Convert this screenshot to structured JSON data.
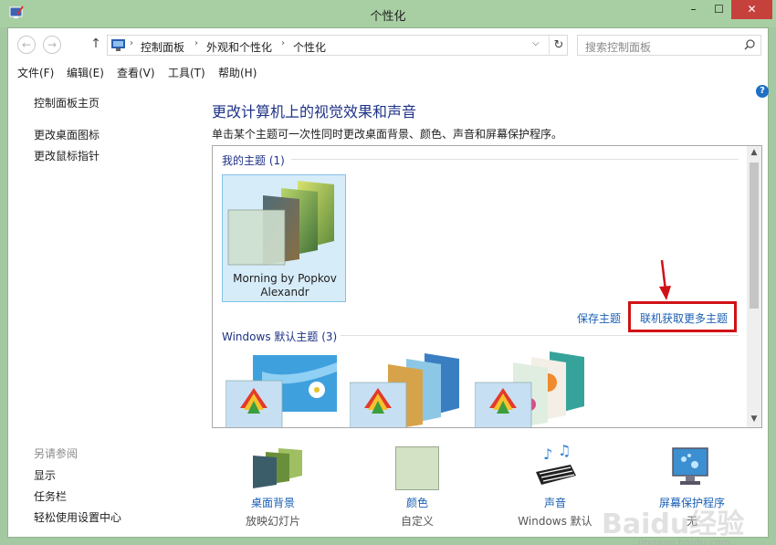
{
  "window": {
    "title": "个性化",
    "buttons": {
      "minimize": "–",
      "maximize": "☐",
      "close": "✕"
    }
  },
  "address_bar": {
    "breadcrumbs": [
      "控制面板",
      "外观和个性化",
      "个性化"
    ],
    "search_placeholder": "搜索控制面板"
  },
  "menu": [
    "文件(F)",
    "编辑(E)",
    "查看(V)",
    "工具(T)",
    "帮助(H)"
  ],
  "left_nav": {
    "links": [
      "控制面板主页",
      "更改桌面图标",
      "更改鼠标指针"
    ],
    "see_also_label": "另请参阅",
    "see_also": [
      "显示",
      "任务栏",
      "轻松使用设置中心"
    ]
  },
  "content": {
    "heading": "更改计算机上的视觉效果和声音",
    "subheading": "单击某个主题可一次性同时更改桌面背景、颜色、声音和屏幕保护程序。",
    "my_themes_label": "我的主题 (1)",
    "selected_theme": "Morning by Popkov Alexandr",
    "save_theme": "保存主题",
    "get_more_themes": "联机获取更多主题",
    "windows_themes_label": "Windows 默认主题 (3)"
  },
  "bottom": [
    {
      "label": "桌面背景",
      "sub": "放映幻灯片",
      "icon": "desktop-background-icon"
    },
    {
      "label": "颜色",
      "sub": "自定义",
      "icon": "color-swatch-icon"
    },
    {
      "label": "声音",
      "sub": "Windows 默认",
      "icon": "sound-icon"
    },
    {
      "label": "屏幕保护程序",
      "sub": "无",
      "icon": "screensaver-icon"
    }
  ],
  "watermark": {
    "text": "Baidu经验",
    "sub": "jingyan.baidu.com"
  },
  "colors": {
    "title_bar": "#a8cfa3",
    "link": "#1a5fb4",
    "heading": "#1e3287",
    "highlight": "#d01217",
    "close_button": "#c7413c"
  }
}
